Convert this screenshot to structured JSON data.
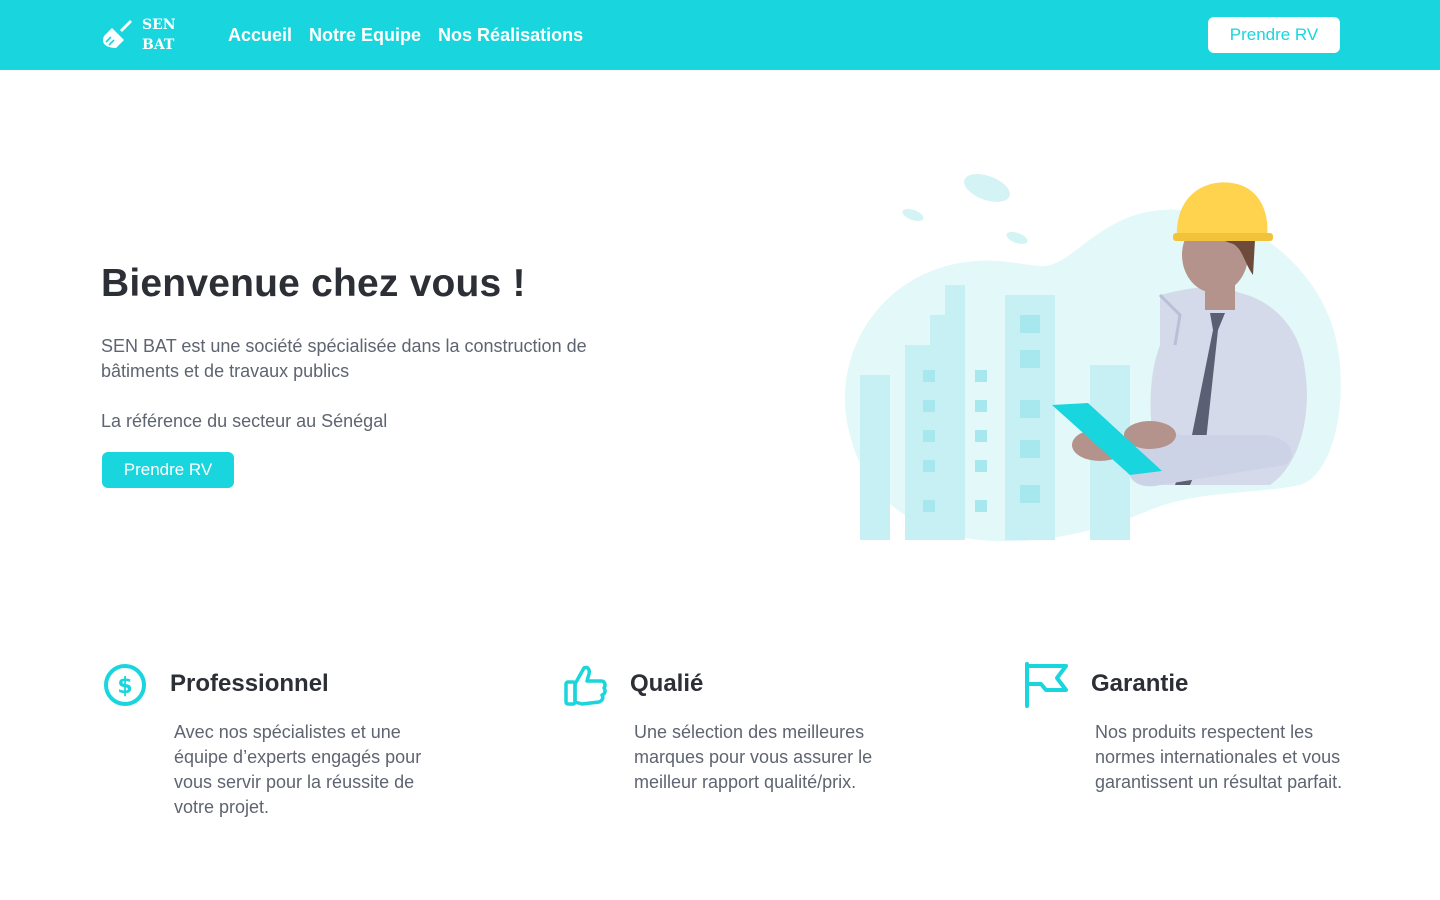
{
  "navbar": {
    "logo_line1": "SEN",
    "logo_line2": "BAT",
    "links": [
      "Accueil",
      "Notre Equipe",
      "Nos Réalisations"
    ],
    "cta": "Prendre RV"
  },
  "hero": {
    "title": "Bienvenue chez vous !",
    "description": "SEN BAT est une société spécialisée dans la construction de bâtiments et de travaux publics",
    "reference": "La référence du secteur au Sénégal",
    "cta": "Prendre RV"
  },
  "features": [
    {
      "icon": "dollar-icon",
      "title": "Professionnel",
      "text": "Avec nos spécialistes et une équipe d’experts engagés pour vous servir pour la réussite de votre projet."
    },
    {
      "icon": "thumbs-up-icon",
      "title": "Qualié",
      "text": "Une sélection des meilleures marques pour vous assurer le meilleur rapport qualité/prix."
    },
    {
      "icon": "flag-icon",
      "title": "Garantie",
      "text": "Nos produits respectent les normes internationales et vous garantissent un résultat parfait."
    }
  ],
  "colors": {
    "accent": "#19d5dd",
    "heading": "#2d2f36",
    "body_text": "#5e6470",
    "helmet": "#ffd34e"
  }
}
